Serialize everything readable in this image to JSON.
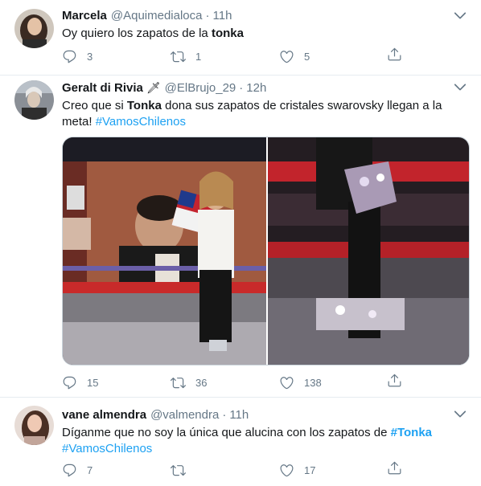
{
  "tweets": [
    {
      "name": "Marcela",
      "handle": "@Aquimedialoca",
      "dot": "·",
      "time": "11h",
      "text_plain": "Oy quiero los zapatos de la ",
      "text_bold": "tonka",
      "replies": "3",
      "retweets": "1",
      "likes": "5"
    },
    {
      "name": "Geralt di Rivia",
      "name_emoji": "🗡",
      "handle": "@ElBrujo_29",
      "dot": "·",
      "time": "12h",
      "text_a": "Creo que si ",
      "text_bold": "Tonka",
      "text_b": " dona sus zapatos de cristales swarovsky llegan a la meta! ",
      "hashtag": "#VamosChilenos",
      "replies": "15",
      "retweets": "36",
      "likes": "138"
    },
    {
      "name": "vane almendra",
      "handle": "@valmendra",
      "dot": "·",
      "time": "11h",
      "text_a": "Díganme que no soy la única que alucina con los zapatos de ",
      "hashtag_bold": "#Tonka",
      "hashtag": "#VamosChilenos",
      "replies": "7",
      "retweets": "",
      "likes": "17"
    }
  ],
  "colors": {
    "accent": "#1da1f2",
    "secondary_text": "#657786",
    "divider": "#e6ecf0"
  },
  "icons": [
    "reply-icon",
    "retweet-icon",
    "like-icon",
    "share-icon",
    "chevron-down-icon"
  ]
}
